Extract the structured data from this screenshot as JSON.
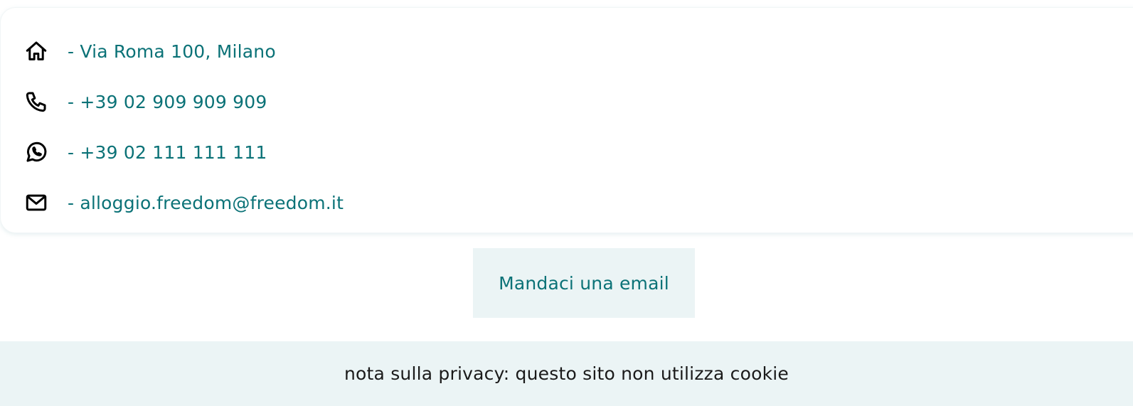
{
  "colors": {
    "accent_text": "#0b7277",
    "tinted_background": "#ebf4f5",
    "icon_stroke": "#000000"
  },
  "contacts": [
    {
      "icon": "home-icon",
      "text": "- Via Roma 100, Milano"
    },
    {
      "icon": "phone-icon",
      "text": "- +39 02 909 909 909"
    },
    {
      "icon": "whatsapp-icon",
      "text": "- +39 02 111 111 111"
    },
    {
      "icon": "mail-icon",
      "text": "- alloggio.freedom@freedom.it"
    }
  ],
  "email_button": {
    "label": "Mandaci una email"
  },
  "footer": {
    "privacy_note": "nota sulla privacy: questo sito non utilizza cookie"
  }
}
